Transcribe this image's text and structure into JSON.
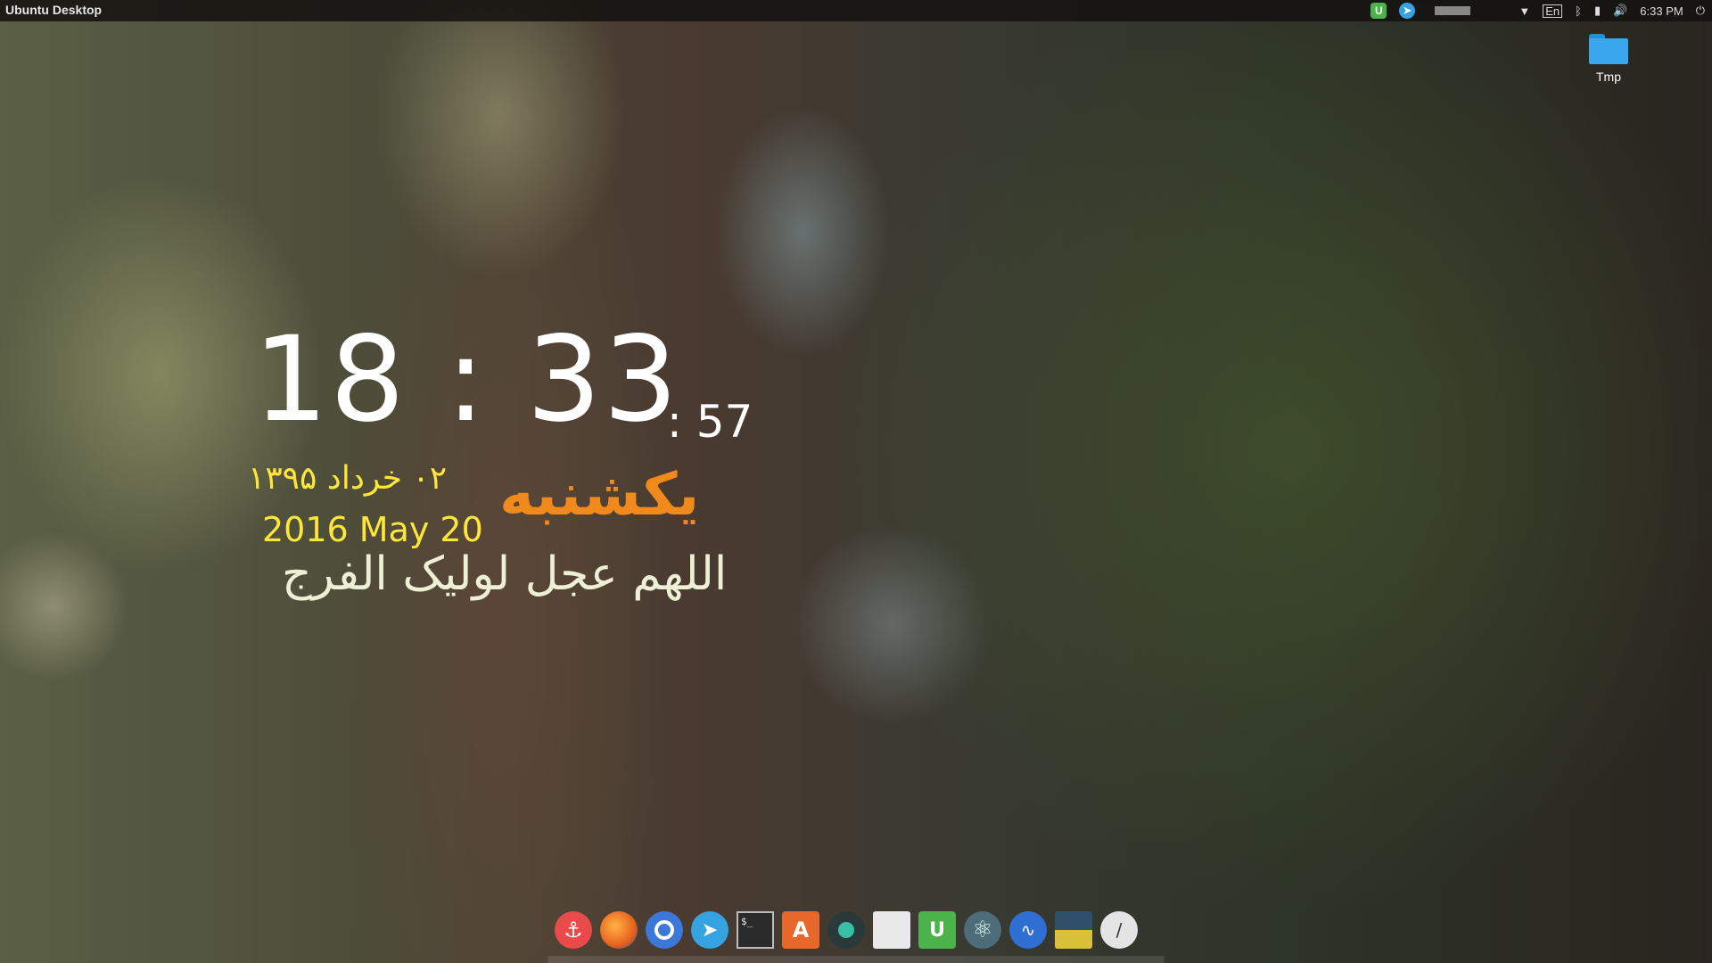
{
  "panel": {
    "title": "Ubuntu Desktop",
    "keyboard_layout": "En",
    "time": "6:33 PM",
    "tray_icons": [
      "upwork-icon",
      "telegram-icon",
      "battery-bar",
      "wifi-icon",
      "keyboard-layout-icon",
      "bluetooth-icon",
      "battery-icon",
      "volume-icon",
      "power-icon"
    ]
  },
  "desktop": {
    "icons": [
      {
        "label": "Tmp",
        "icon": "folder-icon"
      }
    ]
  },
  "clock_widget": {
    "hours_minutes": "18 : 33",
    "seconds": ": 57",
    "persian_date": "۰۲ خرداد ۱۳۹۵",
    "weekday": "یکشنبه",
    "gregorian_date": "2016 May 20",
    "prayer": "اللهم عجل لولیک الفرج"
  },
  "dock": {
    "items": [
      {
        "name": "anchor-app-icon",
        "color": "#e94b4b"
      },
      {
        "name": "firefox-icon",
        "color": "#e8621c"
      },
      {
        "name": "chromium-icon",
        "color": "#3b78d8"
      },
      {
        "name": "telegram-icon",
        "color": "#35a3e0"
      },
      {
        "name": "terminal-icon",
        "color": "#2b2b2b"
      },
      {
        "name": "software-center-icon",
        "color": "#e8672a"
      },
      {
        "name": "media-player-icon",
        "color": "#2a3a3a"
      },
      {
        "name": "files-icon",
        "color": "#e9e9e9"
      },
      {
        "name": "upwork-icon",
        "color": "#4cb34b"
      },
      {
        "name": "atom-icon",
        "color": "#4d6c7a"
      },
      {
        "name": "system-monitor-icon",
        "color": "#2f6fd1"
      },
      {
        "name": "disk-usage-icon",
        "color": "#2f4f6a"
      },
      {
        "name": "clock-app-icon",
        "color": "#e4e4e4"
      }
    ]
  }
}
